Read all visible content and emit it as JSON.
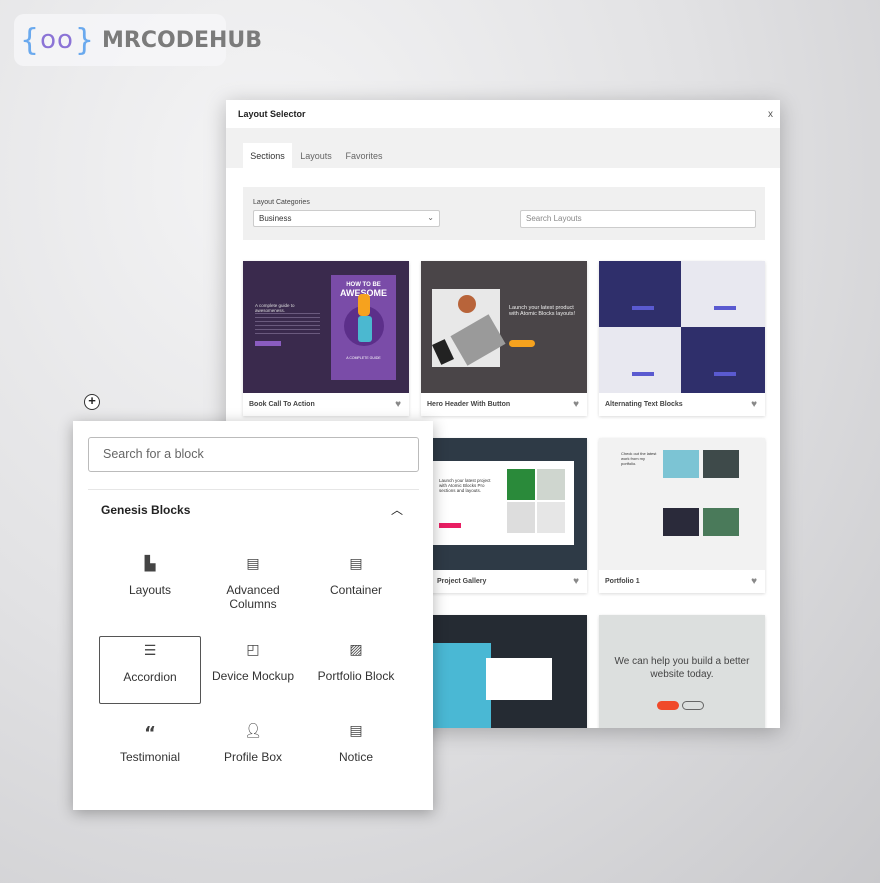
{
  "logo": {
    "brace_open": "{",
    "eyes": "oo",
    "brace_close": "}",
    "text": "MRCODEHUB"
  },
  "modal": {
    "title": "Layout Selector",
    "close_label": "x",
    "tabs": [
      {
        "label": "Sections",
        "active": true
      },
      {
        "label": "Layouts"
      },
      {
        "label": "Favorites"
      }
    ],
    "filters": {
      "category_label": "Layout Categories",
      "category_value": "Business",
      "search_placeholder": "Search Layouts"
    },
    "cards": [
      {
        "label": "Book Call To Action",
        "thumb_title": "HOW TO BE",
        "thumb_title2": "AWESOME",
        "thumb_text": "A complete guide to awesomeness.",
        "thumb_footer": "A COMPLETE GUIDE"
      },
      {
        "label": "Hero Header With Button",
        "thumb_text": "Launch your latest product with Atomic Blocks layouts!"
      },
      {
        "label": "Alternating Text Blocks"
      },
      {
        "label": "Project Gallery",
        "thumb_text": "Launch your latest project with Atomic Blocks Pro sections and layouts."
      },
      {
        "label": "Portfolio 1",
        "thumb_text": "Check out the latest work from my portfolio."
      },
      {
        "label": ""
      },
      {
        "label": ""
      },
      {
        "label": "",
        "thumb_text": "We can help you build a better website today."
      }
    ],
    "favorite_icon": "heart-icon"
  },
  "inserter": {
    "search_placeholder": "Search for a block",
    "group_title": "Genesis Blocks",
    "blocks": [
      {
        "label": "Layouts",
        "icon": "layout-icon"
      },
      {
        "label": "Advanced Columns",
        "icon": "columns-icon"
      },
      {
        "label": "Container",
        "icon": "container-icon"
      },
      {
        "label": "Accordion",
        "icon": "list-icon",
        "selected": true
      },
      {
        "label": "Device Mockup",
        "icon": "device-icon"
      },
      {
        "label": "Portfolio Block",
        "icon": "gallery-icon"
      },
      {
        "label": "Testimonial",
        "icon": "quote-icon"
      },
      {
        "label": "Profile Box",
        "icon": "person-icon"
      },
      {
        "label": "Notice",
        "icon": "notice-icon"
      }
    ]
  },
  "colors": {
    "purple_dark": "#3a2a4d",
    "purple": "#7a4ca8",
    "navy": "#2f2f6b",
    "accent_orange": "#f6a21e",
    "accent_pink": "#e91e63",
    "accent_red": "#f04a2a"
  }
}
